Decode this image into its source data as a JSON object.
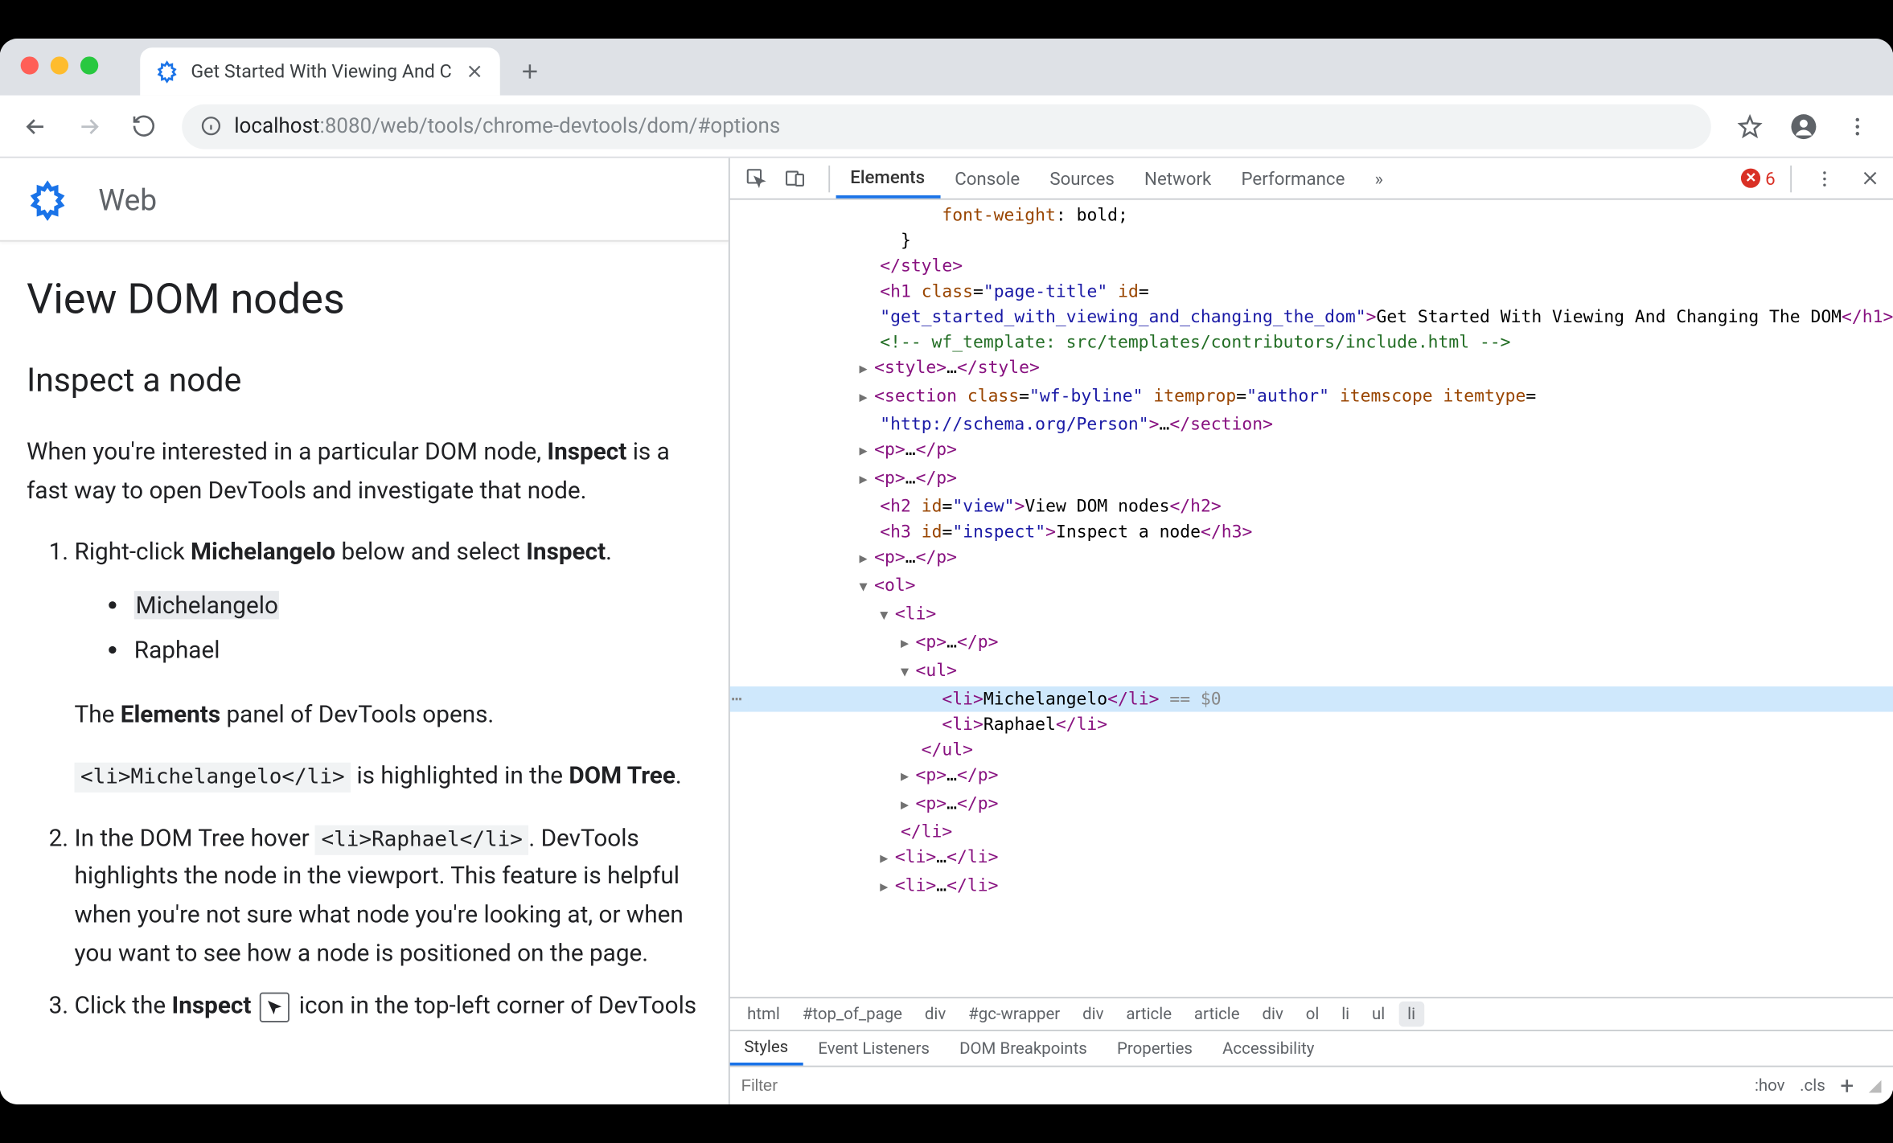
{
  "browser": {
    "tab_title": "Get Started With Viewing And C",
    "url_host": "localhost",
    "url_port": ":8080",
    "url_path": "/web/tools/chrome-devtools/dom/#options"
  },
  "page": {
    "site_name": "Web",
    "h1": "View DOM nodes",
    "h2": "Inspect a node",
    "intro_before": "When you're interested in a particular DOM node, ",
    "intro_bold": "Inspect",
    "intro_after": " is a fast way to open DevTools and investigate that node.",
    "step1_a": "Right-click ",
    "step1_b": "Michelangelo",
    "step1_c": " below and select ",
    "step1_d": "Inspect",
    "step1_e": ".",
    "bullets": [
      "Michelangelo",
      "Raphael"
    ],
    "step1_panel_a": "The ",
    "step1_panel_b": "Elements",
    "step1_panel_c": " panel of DevTools opens.",
    "step1_code": "<li>Michelangelo</li>",
    "step1_code_after_a": " is highlighted in the ",
    "step1_code_after_b": "DOM Tree",
    "step1_code_after_c": ".",
    "step2_a": "In the DOM Tree hover ",
    "step2_code": "<li>Raphael</li>",
    "step2_b": ". DevTools highlights the node in the viewport. This feature is helpful when you're not sure what node you're looking at, or when you want to see how a node is positioned on the page.",
    "step3_a": "Click the ",
    "step3_b": "Inspect",
    "step3_c": " icon in the top-left corner of DevTools"
  },
  "devtools": {
    "tabs": [
      "Elements",
      "Console",
      "Sources",
      "Network",
      "Performance"
    ],
    "more_symbol": "»",
    "error_count": "6",
    "breadcrumb": [
      "html",
      "#top_of_page",
      "div",
      "#gc-wrapper",
      "div",
      "article",
      "article",
      "div",
      "ol",
      "li",
      "ul",
      "li"
    ],
    "styles_tabs": [
      "Styles",
      "Event Listeners",
      "DOM Breakpoints",
      "Properties",
      "Accessibility"
    ],
    "filter_placeholder": "Filter",
    "hov": ":hov",
    "cls": ".cls",
    "dom": {
      "line_font": "font-weight: bold;",
      "h1_text": "Get Started With Viewing And Changing The DOM",
      "h1_class": "page-title",
      "h1_id": "get_started_with_viewing_and_changing_the_dom",
      "comment": "<!-- wf_template: src/templates/contributors/include.html -->",
      "section_class": "wf-byline",
      "section_itemprop": "author",
      "section_itemtype": "http://schema.org/Person",
      "h2_id": "view",
      "h2_text": "View DOM nodes",
      "h3_id": "inspect",
      "h3_text": "Inspect a node",
      "li1": "Michelangelo",
      "li2": "Raphael",
      "eqvar": "== $0"
    }
  }
}
